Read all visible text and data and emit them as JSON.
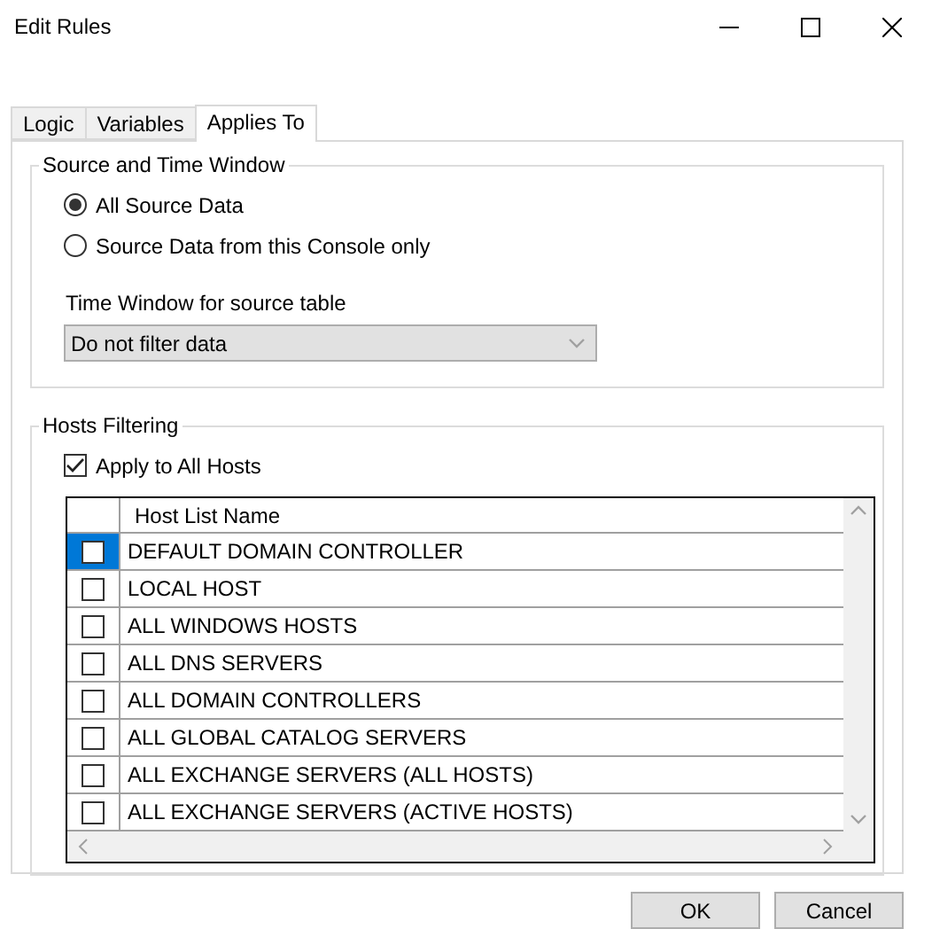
{
  "window": {
    "title": "Edit Rules"
  },
  "tabs": [
    {
      "label": "Logic",
      "selected": false
    },
    {
      "label": "Variables",
      "selected": false
    },
    {
      "label": "Applies To",
      "selected": true
    }
  ],
  "source_group": {
    "title": "Source and Time Window",
    "options": [
      {
        "label": "All Source Data",
        "selected": true
      },
      {
        "label": "Source Data from this Console only",
        "selected": false
      }
    ],
    "time_window_label": "Time Window for source table",
    "time_window_value": "Do not filter data"
  },
  "hosts_group": {
    "title": "Hosts Filtering",
    "apply_all": {
      "label": "Apply to All Hosts",
      "checked": true
    },
    "table": {
      "columns": [
        "Host List Name"
      ],
      "rows": [
        {
          "name": "DEFAULT DOMAIN CONTROLLER",
          "checked": false,
          "selected": true
        },
        {
          "name": "LOCAL HOST",
          "checked": false,
          "selected": false
        },
        {
          "name": "ALL WINDOWS HOSTS",
          "checked": false,
          "selected": false
        },
        {
          "name": "ALL DNS SERVERS",
          "checked": false,
          "selected": false
        },
        {
          "name": "ALL DOMAIN CONTROLLERS",
          "checked": false,
          "selected": false
        },
        {
          "name": "ALL GLOBAL CATALOG SERVERS",
          "checked": false,
          "selected": false
        },
        {
          "name": "ALL EXCHANGE SERVERS (ALL HOSTS)",
          "checked": false,
          "selected": false
        },
        {
          "name": "ALL EXCHANGE SERVERS (ACTIVE HOSTS)",
          "checked": false,
          "selected": false
        }
      ]
    }
  },
  "buttons": [
    {
      "label": "OK"
    },
    {
      "label": "Cancel"
    }
  ]
}
